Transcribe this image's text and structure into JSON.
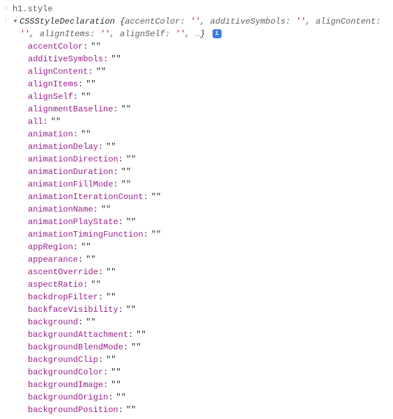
{
  "input": {
    "expression": "h1.style"
  },
  "result": {
    "typeName": "CSSStyleDeclaration",
    "summaryPairs": [
      {
        "key": "accentColor",
        "val": "''"
      },
      {
        "key": "additiveSymbols",
        "val": "''"
      },
      {
        "key": "alignContent",
        "val": "''"
      },
      {
        "key": "alignItems",
        "val": "''"
      },
      {
        "key": "alignSelf",
        "val": "''"
      }
    ],
    "summaryEllipsis": "…",
    "infoBadge": "i"
  },
  "properties": [
    {
      "key": "accentColor",
      "val": "\"\""
    },
    {
      "key": "additiveSymbols",
      "val": "\"\""
    },
    {
      "key": "alignContent",
      "val": "\"\""
    },
    {
      "key": "alignItems",
      "val": "\"\""
    },
    {
      "key": "alignSelf",
      "val": "\"\""
    },
    {
      "key": "alignmentBaseline",
      "val": "\"\""
    },
    {
      "key": "all",
      "val": "\"\""
    },
    {
      "key": "animation",
      "val": "\"\""
    },
    {
      "key": "animationDelay",
      "val": "\"\""
    },
    {
      "key": "animationDirection",
      "val": "\"\""
    },
    {
      "key": "animationDuration",
      "val": "\"\""
    },
    {
      "key": "animationFillMode",
      "val": "\"\""
    },
    {
      "key": "animationIterationCount",
      "val": "\"\""
    },
    {
      "key": "animationName",
      "val": "\"\""
    },
    {
      "key": "animationPlayState",
      "val": "\"\""
    },
    {
      "key": "animationTimingFunction",
      "val": "\"\""
    },
    {
      "key": "appRegion",
      "val": "\"\""
    },
    {
      "key": "appearance",
      "val": "\"\""
    },
    {
      "key": "ascentOverride",
      "val": "\"\""
    },
    {
      "key": "aspectRatio",
      "val": "\"\""
    },
    {
      "key": "backdropFilter",
      "val": "\"\""
    },
    {
      "key": "backfaceVisibility",
      "val": "\"\""
    },
    {
      "key": "background",
      "val": "\"\""
    },
    {
      "key": "backgroundAttachment",
      "val": "\"\""
    },
    {
      "key": "backgroundBlendMode",
      "val": "\"\""
    },
    {
      "key": "backgroundClip",
      "val": "\"\""
    },
    {
      "key": "backgroundColor",
      "val": "\"\""
    },
    {
      "key": "backgroundImage",
      "val": "\"\""
    },
    {
      "key": "backgroundOrigin",
      "val": "\"\""
    },
    {
      "key": "backgroundPosition",
      "val": "\"\""
    }
  ]
}
